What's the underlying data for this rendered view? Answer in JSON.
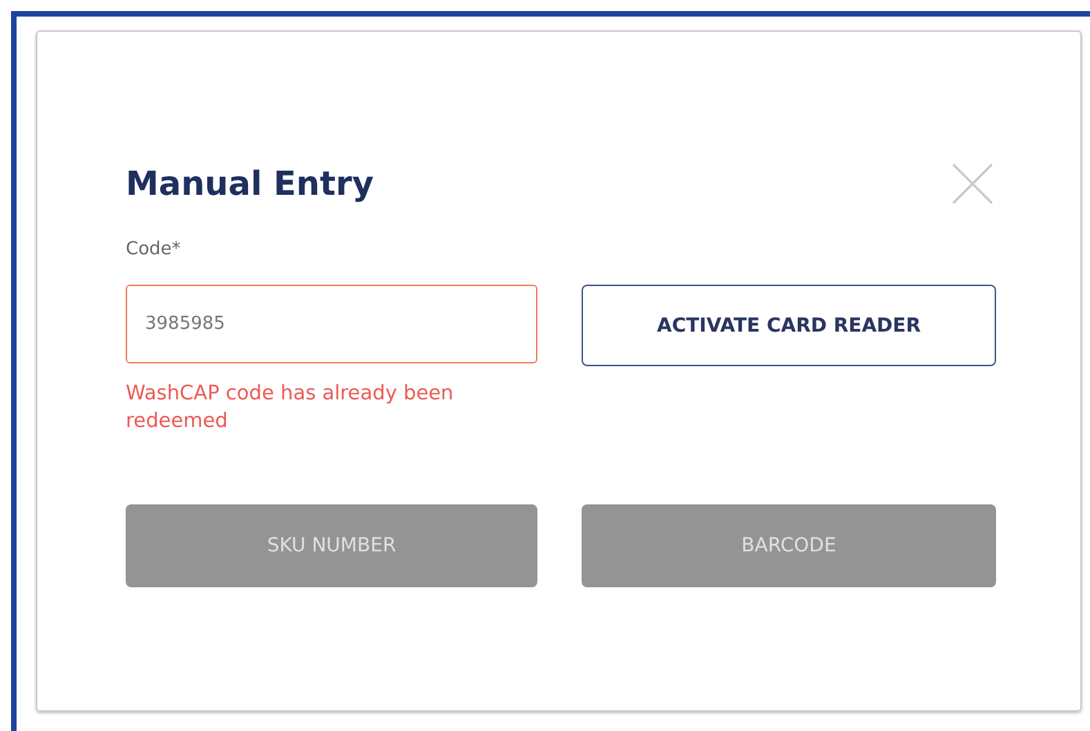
{
  "dialog": {
    "title": "Manual Entry",
    "code_field": {
      "label": "Code*",
      "value": "3985985",
      "invalid": true,
      "error": "WashCAP code has already been redeemed"
    },
    "buttons": [
      {
        "label": "ACTIVATE CARD READER",
        "disabled": false
      },
      {
        "label": "SKU NUMBER",
        "disabled": true
      },
      {
        "label": "BARCODE",
        "disabled": true
      }
    ]
  }
}
